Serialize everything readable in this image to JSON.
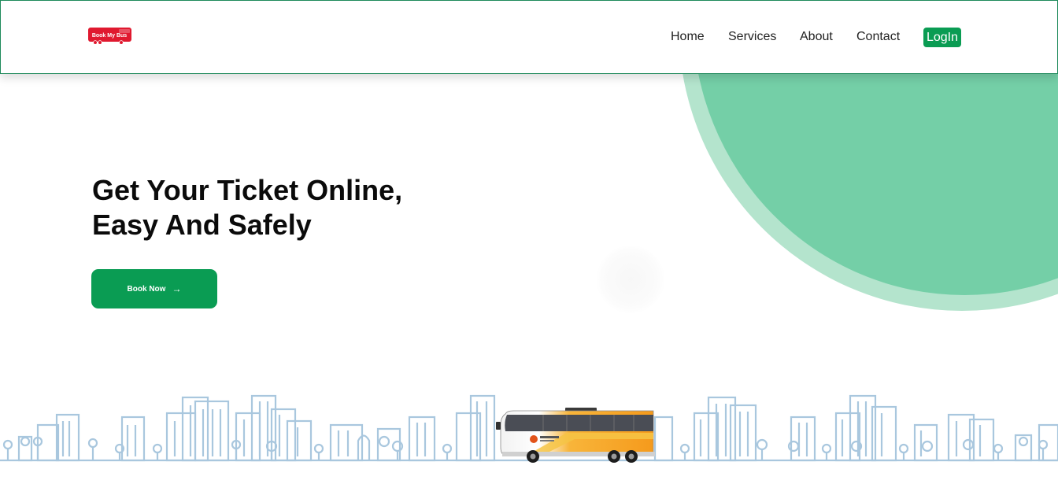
{
  "brand": {
    "logo_text": "Book My Bus",
    "logo_color": "#e0192f"
  },
  "nav": {
    "items": [
      "Home",
      "Services",
      "About",
      "Contact"
    ],
    "login_label": "LogIn"
  },
  "hero": {
    "title_line1": "Get Your Ticket Online,",
    "title_line2": "Easy And Safely",
    "cta_label": "Book Now",
    "cta_icon": "arrow-right-icon"
  },
  "colors": {
    "accent": "#0a9c53",
    "circle": "#74cfa7",
    "skyline": "#a9c7de"
  }
}
